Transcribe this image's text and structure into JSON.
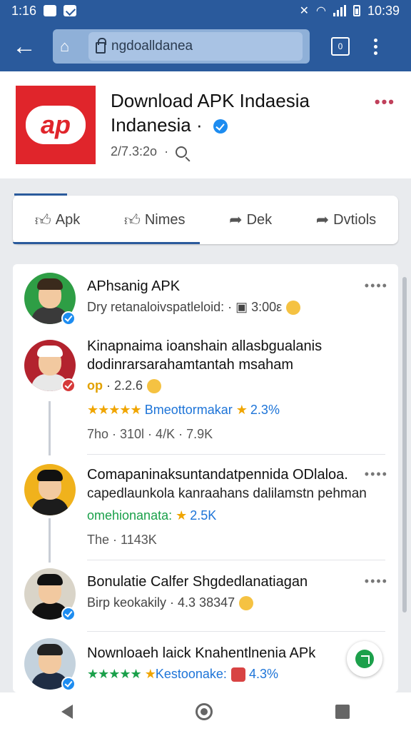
{
  "status": {
    "time": "1:16",
    "clock": "10:39"
  },
  "browser": {
    "url": "ngdoalldanea",
    "tabs_count": "0"
  },
  "header": {
    "title_line1": "Download APK Indaesia",
    "title_line2": "Indanesia",
    "meta": "2/7.3:2o",
    "logo_text": "ap"
  },
  "actions": [
    {
      "label": "Apk",
      "icon": "thumbs-up-icon"
    },
    {
      "label": "Nimes",
      "icon": "thumbs-up-icon"
    },
    {
      "label": "Dek",
      "icon": "share-icon"
    },
    {
      "label": "Dvtiols",
      "icon": "share-icon"
    }
  ],
  "posts": [
    {
      "name": "APhsanig APK",
      "line1": "Dry retanaloivspatleloid: ·",
      "line1b": "3:00ε"
    },
    {
      "name": "Kinapnaima ioanshain allasbgualanis",
      "name2": "dodinrarsarahamtantah msaham",
      "line1": "· 2.2.6",
      "tag": "op",
      "stars": "★★★★★",
      "line2": "Bmeottormakar",
      "line2b": "2.3%",
      "line3": "7ho · 310l · 4/K · 7.9K"
    },
    {
      "name": "Comapaninaksuntandatpennida ODlaloa.",
      "name2": "capedlaunkola kanraahans dalilamstn pehman",
      "line1": "omehionanata:",
      "line1b": "2.5K",
      "line2": "The · 1143K"
    },
    {
      "name": "Bonulatie Calfer Shgdedlanatiagan",
      "line1": "Birp keokakily · 4.3 38347"
    },
    {
      "name": "Nownloaeh laick Knahentlnenia APk",
      "stars": "★★★★★",
      "line1": "Kestoonake:",
      "line1b": "4.3%"
    }
  ],
  "colors": {
    "accent": "#2a5a9c",
    "brand_red": "#e0252b"
  }
}
